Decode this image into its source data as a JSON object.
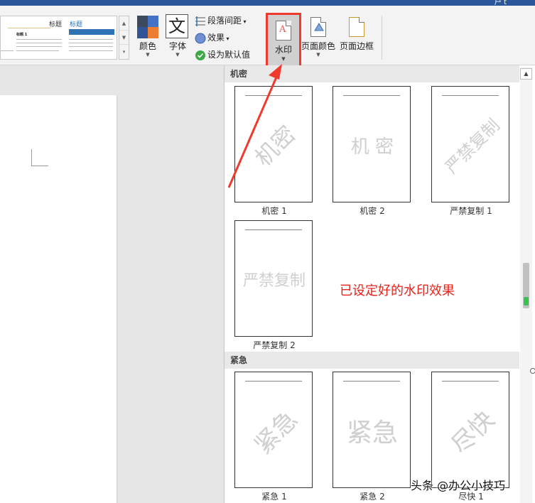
{
  "title_bar": {
    "text": "户 t"
  },
  "ribbon": {
    "style_gallery": {
      "item1_title": "标题",
      "item1_heading": "标题 1",
      "item2_title": "标题"
    },
    "colors_label": "颜色",
    "fonts_label": "字体",
    "paragraph_spacing_label": "段落间距",
    "effects_label": "效果",
    "set_default_label": "设为默认值",
    "watermark_label": "水印",
    "page_color_label": "页面颜色",
    "page_borders_label": "页面边框"
  },
  "watermark_gallery": {
    "sections": [
      {
        "header": "机密",
        "items": [
          {
            "text": "机密",
            "caption": "机密 1",
            "rotated": true
          },
          {
            "text": "机 密",
            "caption": "机密 2",
            "rotated": false
          },
          {
            "text": "严禁复制",
            "caption": "严禁复制 1",
            "rotated": true
          },
          {
            "text": "严禁复制",
            "caption": "严禁复制 2",
            "rotated": false
          }
        ]
      },
      {
        "header": "紧急",
        "items": [
          {
            "text": "紧急",
            "caption": "紧急 1",
            "rotated": true
          },
          {
            "text": "紧急",
            "caption": "紧急 2",
            "rotated": false
          },
          {
            "text": "尽快",
            "caption": "尽快 1",
            "rotated": true
          }
        ]
      }
    ]
  },
  "annotation": "已设定好的水印效果",
  "credit": "头条 @办公小技巧",
  "colors": {
    "highlight_border": "#f03a2e",
    "annotation": "#e5231b",
    "watermark_text": "#cfcfcf",
    "theme_swatch_1": "#3b4a5e",
    "theme_swatch_2": "#4472c4",
    "theme_swatch_3": "#2f5597",
    "theme_swatch_4": "#ed7d31"
  }
}
